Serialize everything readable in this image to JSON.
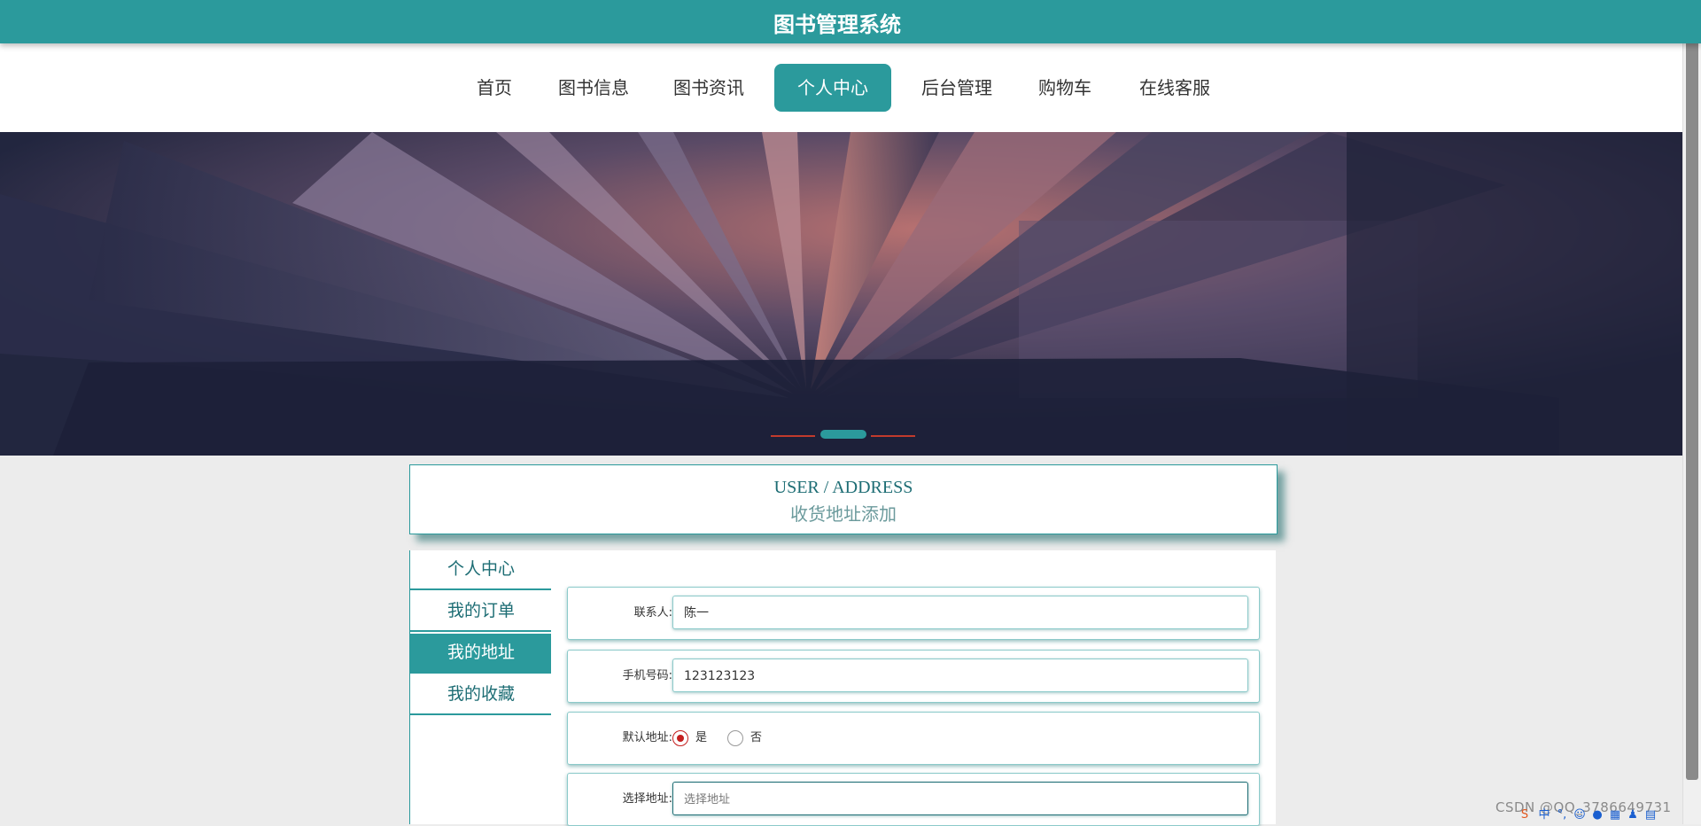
{
  "app": {
    "title": "图书管理系统"
  },
  "nav": {
    "items": [
      {
        "label": "首页"
      },
      {
        "label": "图书信息"
      },
      {
        "label": "图书资讯"
      },
      {
        "label": "个人中心"
      },
      {
        "label": "后台管理"
      },
      {
        "label": "购物车"
      },
      {
        "label": "在线客服"
      }
    ],
    "active": "个人中心"
  },
  "banner": {
    "active_slide": 2,
    "slide_count": 3
  },
  "page_header": {
    "en": "USER / ADDRESS",
    "cn": "收货地址添加"
  },
  "side_menu": {
    "items": [
      {
        "label": "个人中心"
      },
      {
        "label": "我的订单"
      },
      {
        "label": "我的地址"
      },
      {
        "label": "我的收藏"
      }
    ],
    "active": "我的地址"
  },
  "form": {
    "contact": {
      "label": "联系人:",
      "value": "陈一"
    },
    "phone": {
      "label": "手机号码:",
      "value": "123123123"
    },
    "default": {
      "label": "默认地址:",
      "options": [
        {
          "label": "是",
          "checked": true
        },
        {
          "label": "否",
          "checked": false
        }
      ]
    },
    "address": {
      "label": "选择地址:",
      "placeholder": "选择地址",
      "value": ""
    }
  },
  "watermark": "CSDN @QQ_3786649731",
  "tray_icons": [
    "sogou-icon",
    "chinese-input-icon",
    "punctuation-icon",
    "emoji-icon",
    "mic-icon",
    "keyboard-icon",
    "skin-icon",
    "toolbox-icon"
  ],
  "colors": {
    "accent": "#2b9a9c",
    "accent_dark": "#1d6d74",
    "radio": "#c41e1e"
  }
}
